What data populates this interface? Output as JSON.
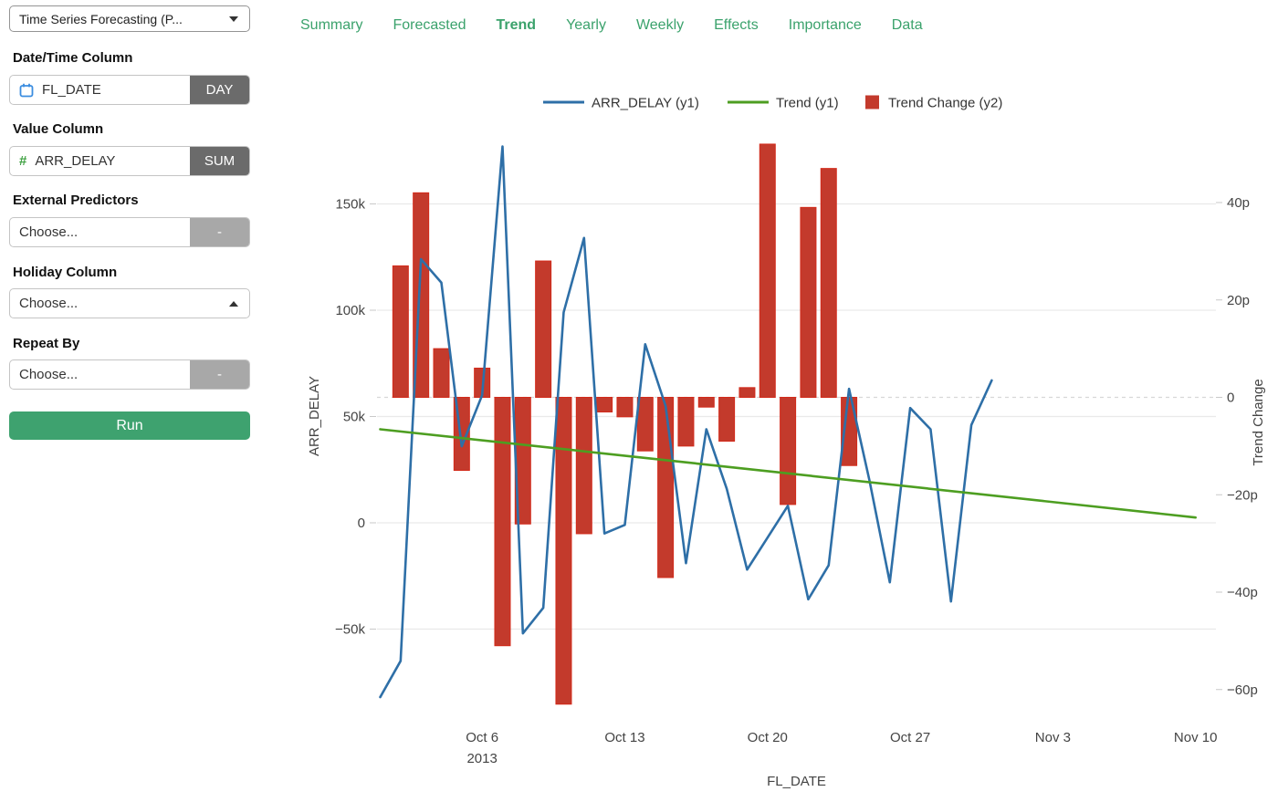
{
  "sidebar": {
    "analysis_type": "Time Series Forecasting (P...",
    "fields": {
      "date": {
        "label": "Date/Time Column",
        "value": "FL_DATE",
        "addon": "DAY"
      },
      "value": {
        "label": "Value Column",
        "value": "ARR_DELAY",
        "addon": "SUM"
      },
      "predictors": {
        "label": "External Predictors",
        "value": "Choose...",
        "addon": "-"
      },
      "holiday": {
        "label": "Holiday Column",
        "value": "Choose..."
      },
      "repeat": {
        "label": "Repeat By",
        "value": "Choose...",
        "addon": "-"
      }
    },
    "run_label": "Run"
  },
  "tabs": [
    {
      "label": "Summary",
      "active": false
    },
    {
      "label": "Forecasted",
      "active": false
    },
    {
      "label": "Trend",
      "active": true
    },
    {
      "label": "Yearly",
      "active": false
    },
    {
      "label": "Weekly",
      "active": false
    },
    {
      "label": "Effects",
      "active": false
    },
    {
      "label": "Importance",
      "active": false
    },
    {
      "label": "Data",
      "active": false
    }
  ],
  "chart_data": {
    "type": "line+bar",
    "x_axis": {
      "label": "FL_DATE",
      "tick_labels": [
        "Oct 6",
        "Oct 13",
        "Oct 20",
        "Oct 27",
        "Nov 3",
        "Nov 10"
      ],
      "tick_days": [
        5,
        12,
        19,
        26,
        33,
        40
      ],
      "year_label": "2013",
      "year_tick_index": 0
    },
    "y1_axis": {
      "label": "ARR_DELAY",
      "tick_labels": [
        "150k",
        "100k",
        "50k",
        "0",
        "−50k"
      ],
      "tick_values": [
        150,
        100,
        50,
        0,
        -50
      ],
      "unit": "thousands"
    },
    "y2_axis": {
      "label": "Trend Change",
      "tick_labels": [
        "40p",
        "20p",
        "0",
        "−20p",
        "−40p",
        "−60p"
      ],
      "tick_values": [
        40,
        20,
        0,
        -20,
        -40,
        -60
      ],
      "zero_line": "dashed"
    },
    "legend": [
      {
        "label": "ARR_DELAY (y1)",
        "swatch": "line",
        "color": "#2e6fa7"
      },
      {
        "label": "Trend (y1)",
        "swatch": "line",
        "color": "#4d9e21"
      },
      {
        "label": "Trend Change (y2)",
        "swatch": "square",
        "color": "#c33a2c"
      }
    ],
    "series": [
      {
        "name": "ARR_DELAY",
        "axis": "y1",
        "type": "line",
        "color": "#2e6fa7",
        "x_days": [
          0,
          1,
          2,
          3,
          4,
          5,
          6,
          7,
          8,
          9,
          10,
          11,
          12,
          13,
          14,
          15,
          16,
          17,
          18,
          19,
          20,
          21,
          22,
          23,
          24,
          25,
          26,
          27,
          28,
          29,
          30
        ],
        "values_k": [
          -82,
          -65,
          124,
          113,
          36,
          60,
          177,
          -52,
          -40,
          99,
          134,
          -5,
          -1,
          84,
          55,
          -19,
          44,
          16,
          -22,
          -7,
          8,
          -36,
          -20,
          63,
          20,
          -28,
          54,
          44,
          -37,
          46,
          67
        ]
      },
      {
        "name": "Trend",
        "axis": "y1",
        "type": "line",
        "color": "#4d9e21",
        "x_days": [
          0,
          40
        ],
        "values_k": [
          44,
          2.5
        ]
      },
      {
        "name": "Trend Change",
        "axis": "y2",
        "type": "bar",
        "color": "#c33a2c",
        "border_color": "#d32a1a",
        "x_days": [
          1,
          2,
          3,
          4,
          5,
          6,
          7,
          8,
          9,
          10,
          11,
          12,
          13,
          14,
          15,
          16,
          17,
          18,
          19,
          20,
          21,
          22,
          23
        ],
        "values_p": [
          27,
          42,
          10,
          -15,
          6,
          -51,
          -26,
          28,
          -63,
          -28,
          -3,
          -4,
          -11,
          -37,
          -10,
          -2,
          -9,
          2,
          52,
          -22,
          39,
          47,
          -14
        ]
      }
    ]
  }
}
